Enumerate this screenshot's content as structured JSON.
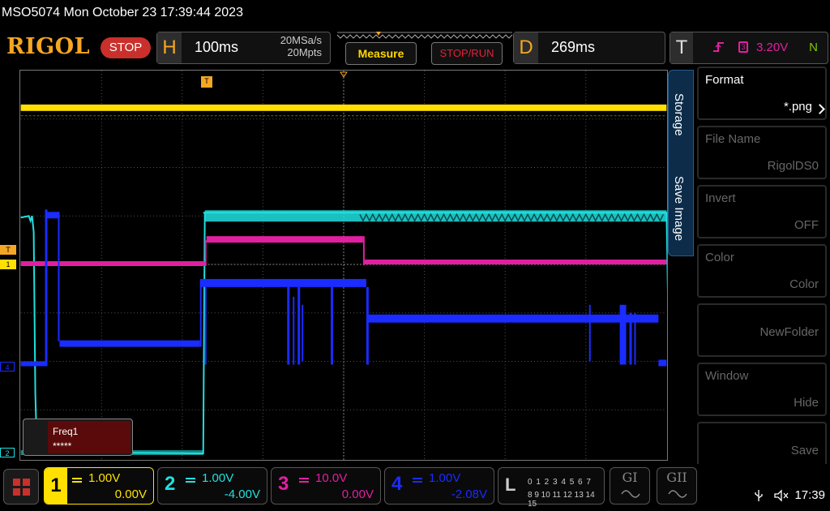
{
  "titlebar": {
    "text": "MSO5074  Mon October 23 17:39:44 2023"
  },
  "topbar": {
    "logo": "RIGOL",
    "run_state": "STOP",
    "horizontal": {
      "letter": "H",
      "timebase": "100ms",
      "sample_rate": "20MSa/s",
      "memory_depth": "20Mpts"
    },
    "measure_label": "Measure",
    "stop_run_label": "STOP/RUN",
    "delay": {
      "letter": "D",
      "value": "269ms"
    },
    "trigger": {
      "letter": "T",
      "source": "3",
      "level": "3.20V",
      "mode": "N"
    }
  },
  "side_tab": {
    "storage": "Storage",
    "save_image": "Save Image"
  },
  "menu": [
    {
      "label": "Format",
      "value": "*.png",
      "enabled": true
    },
    {
      "label": "File Name",
      "value": "RigolDS0",
      "enabled": false
    },
    {
      "label": "Invert",
      "value": "OFF",
      "enabled": false
    },
    {
      "label": "Color",
      "value": "Color",
      "enabled": false
    },
    {
      "label": "",
      "value": "NewFolder",
      "enabled": false
    },
    {
      "label": "Window",
      "value": "Hide",
      "enabled": false
    },
    {
      "label": "",
      "value": "Save",
      "enabled": false
    }
  ],
  "measure_box": {
    "name": "Freq1",
    "value": "*****"
  },
  "markers": {
    "trigger_pos": "T",
    "trig_level": "T",
    "ch1": "1",
    "ch2": "2",
    "ch4": "4"
  },
  "channels": [
    {
      "num": "1",
      "scale": "1.00V",
      "offset": "0.00V",
      "color": "#ffe000"
    },
    {
      "num": "2",
      "scale": "1.00V",
      "offset": "-4.00V",
      "color": "#20e0e0"
    },
    {
      "num": "3",
      "scale": "10.0V",
      "offset": "0.00V",
      "color": "#e020a0"
    },
    {
      "num": "4",
      "scale": "1.00V",
      "offset": "-2.08V",
      "color": "#1a2cff"
    }
  ],
  "logic": {
    "letter": "L",
    "row1": "0 1 2 3  4 5 6 7",
    "row2": "8 9 10 11 12 13 14 15"
  },
  "gen1": "GI",
  "gen2": "GII",
  "status": {
    "time": "17:39"
  }
}
